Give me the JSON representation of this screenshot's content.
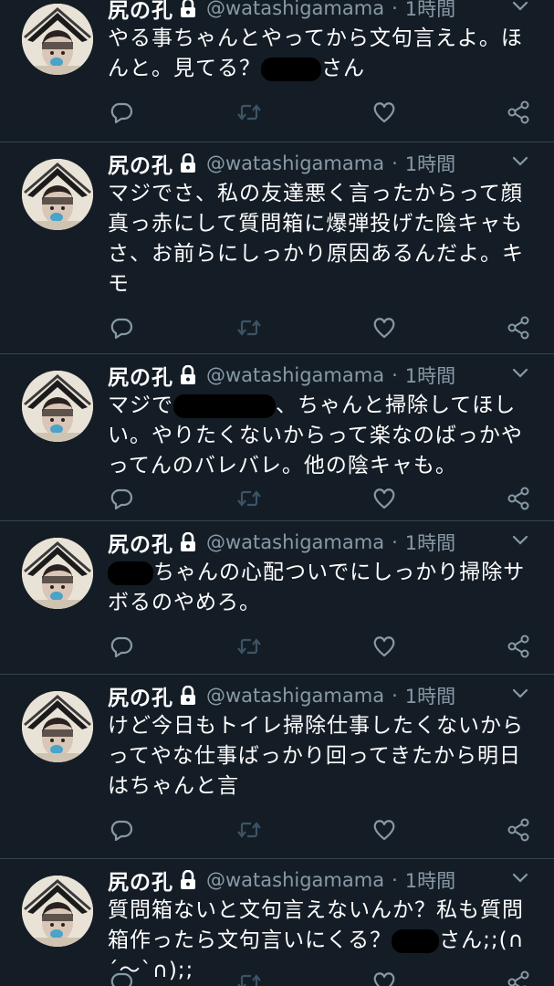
{
  "user": {
    "name": "尻の孔",
    "handle": "@watashigamama",
    "dot": "·"
  },
  "colors": {
    "background": "#141d26",
    "divider": "#38444d",
    "muted": "#8899a6",
    "text": "#ffffff"
  },
  "icons": [
    "lock-icon",
    "chevron-down-icon",
    "reply-icon",
    "retweet-icon",
    "like-icon",
    "share-icon"
  ],
  "tweets": [
    {
      "time": "1時間",
      "lines": [
        [
          {
            "t": "やる事ちゃんとやってから文句言えよ。ほ"
          }
        ],
        [
          {
            "t": "んと。見てる？"
          },
          {
            "r": 66
          },
          {
            "t": "さん"
          }
        ]
      ]
    },
    {
      "time": "1時間",
      "lines": [
        [
          {
            "t": "マジでさ、私の友達悪く言ったからって顔"
          }
        ],
        [
          {
            "t": "真っ赤にして質問箱に爆弾投げた陰キャも"
          }
        ],
        [
          {
            "t": "さ、お前らにしっかり原因あるんだよ。キ"
          }
        ],
        [
          {
            "t": "モ"
          }
        ]
      ]
    },
    {
      "time": "1時間",
      "lines": [
        [
          {
            "t": "マジで"
          },
          {
            "r": 112
          },
          {
            "t": "、ちゃんと掃除してほし"
          }
        ],
        [
          {
            "t": "い。やりたくないからって楽なのばっかや"
          }
        ],
        [
          {
            "t": "ってんのバレバレ。他の陰キャも。"
          }
        ]
      ]
    },
    {
      "time": "1時間",
      "lines": [
        [
          {
            "r": 50
          },
          {
            "t": "ちゃんの心配ついでにしっかり掃除サ"
          }
        ],
        [
          {
            "t": "ボるのやめろ。"
          }
        ]
      ]
    },
    {
      "time": "1時間",
      "lines": [
        [
          {
            "t": "けど今日もトイレ掃除仕事したくないから"
          }
        ],
        [
          {
            "t": "ってやな仕事ばっかり回ってきたから明日"
          }
        ],
        [
          {
            "t": "はちゃんと言"
          }
        ]
      ]
    },
    {
      "time": "1時間",
      "lines": [
        [
          {
            "t": "質問箱ないと文句言えないんか？私も質問"
          }
        ],
        [
          {
            "t": "箱作ったら文句言いにくる？"
          },
          {
            "r": 52
          },
          {
            "t": "さん;;(∩"
          }
        ],
        [
          {
            "t": "´～`∩);;"
          }
        ]
      ]
    }
  ]
}
